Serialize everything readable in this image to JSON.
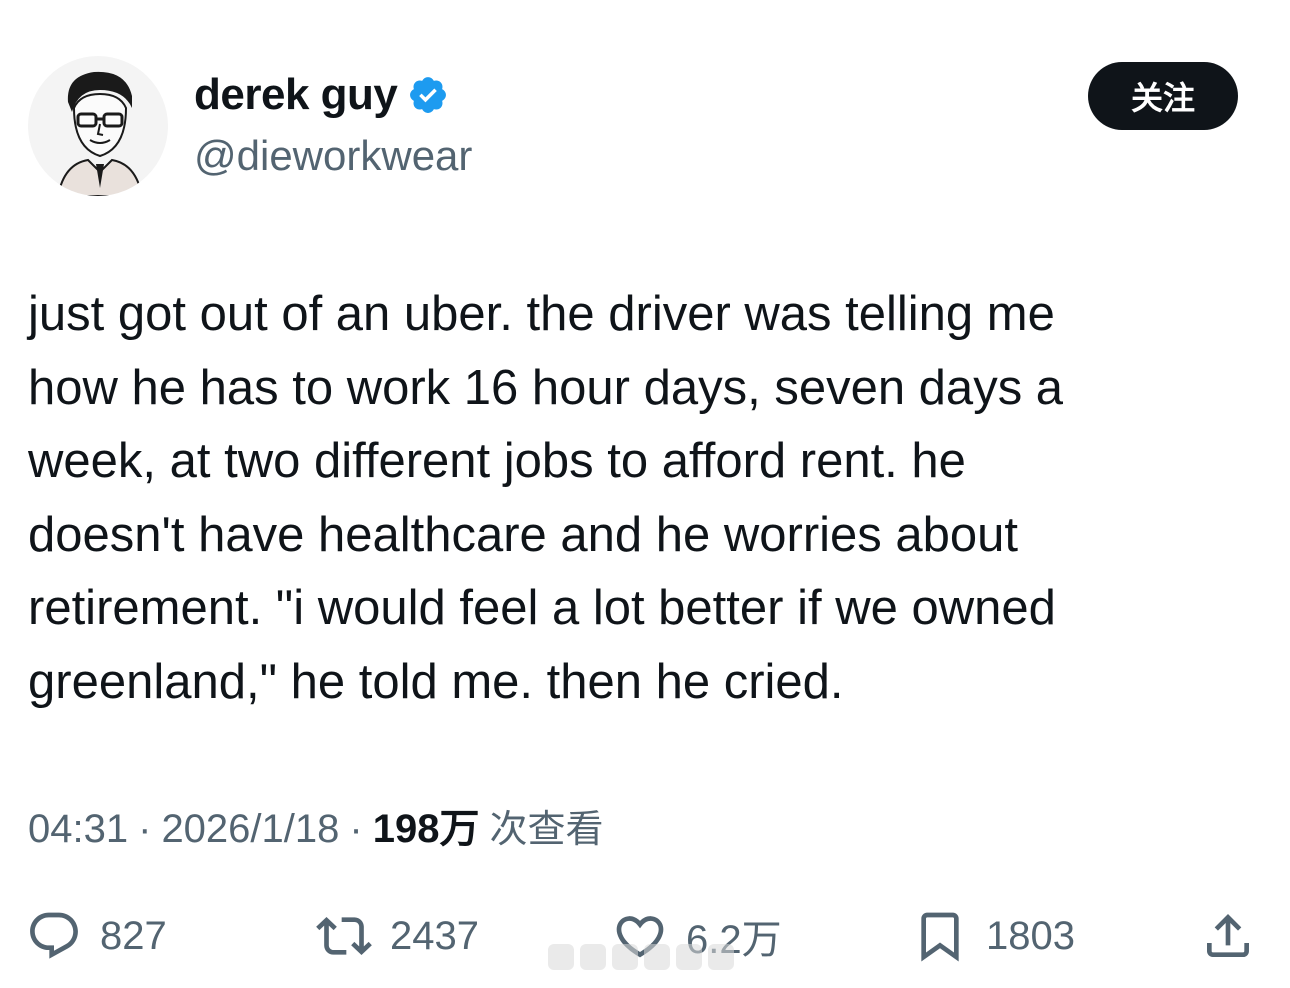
{
  "author": {
    "display_name": "derek guy",
    "handle": "@dieworkwear",
    "verified": true,
    "verified_color": "#1d9bf0"
  },
  "follow_button": {
    "label": "关注"
  },
  "tweet": {
    "text": "just got out of an uber. the driver was telling me\nhow he has to work 16 hour days, seven days a\nweek, at two different jobs to afford rent. he\ndoesn't have healthcare and he worries about\nretirement. \"i would feel a lot better if we owned\ngreenland,\" he told me. then he cried."
  },
  "meta": {
    "time": "04:31",
    "separator": "·",
    "date": "2026/1/18",
    "views_count": "198万",
    "views_label": "次查看"
  },
  "actions": {
    "reply": {
      "icon": "reply-icon",
      "count": "827"
    },
    "retweet": {
      "icon": "retweet-icon",
      "count": "2437"
    },
    "like": {
      "icon": "heart-icon",
      "count": "6.2万"
    },
    "bookmark": {
      "icon": "bookmark-icon",
      "count": "1803"
    },
    "share": {
      "icon": "share-icon"
    }
  },
  "colors": {
    "text_primary": "#0f1419",
    "text_secondary": "#536471",
    "button_bg": "#0f1419"
  }
}
